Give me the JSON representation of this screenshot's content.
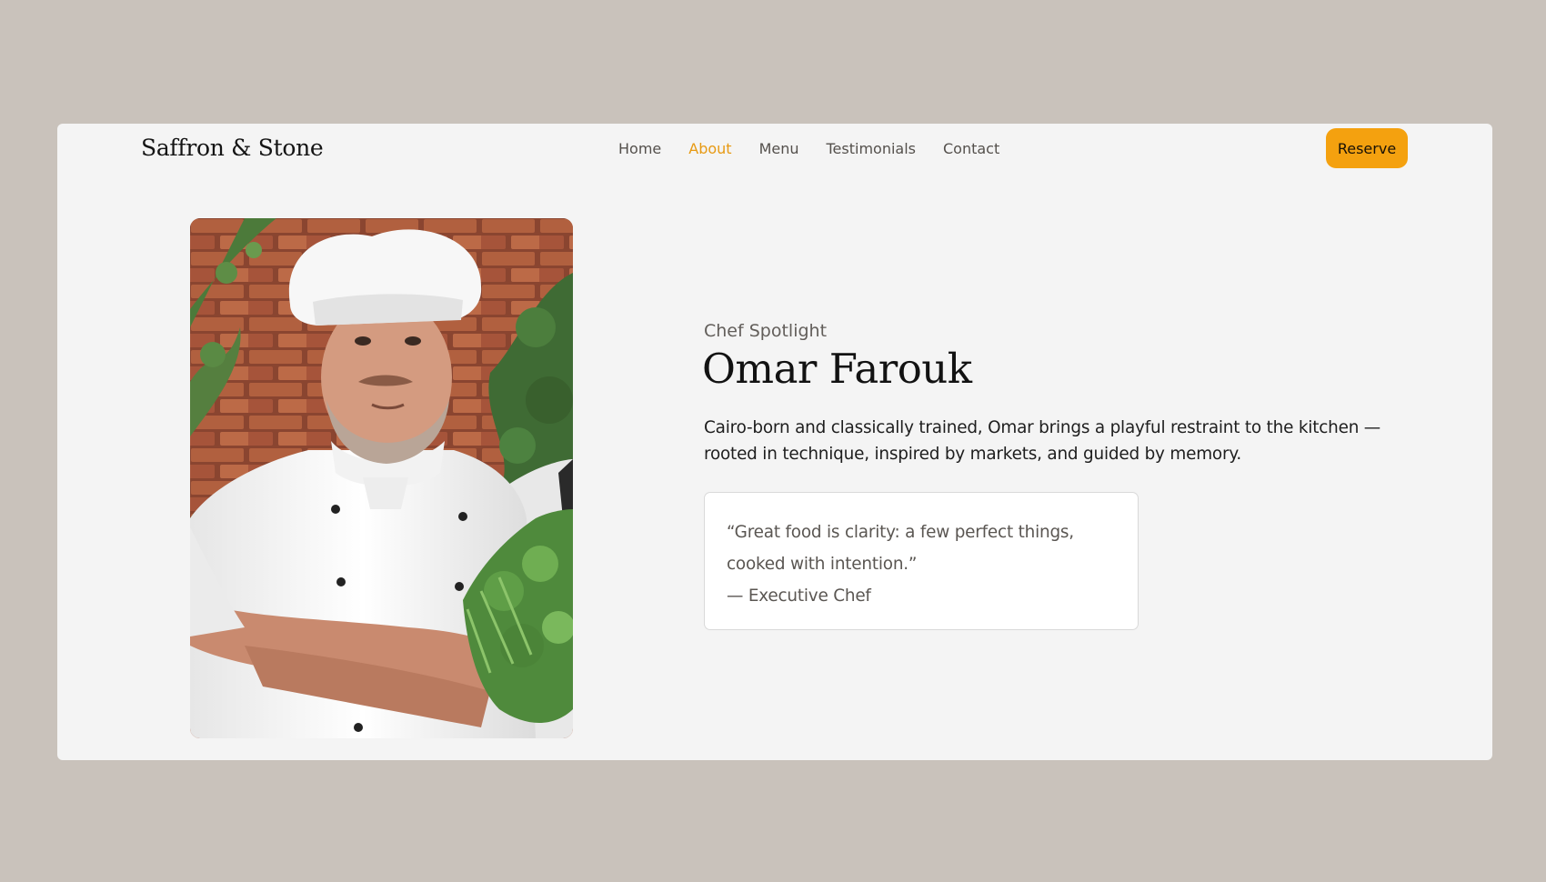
{
  "nav": {
    "brand": "Saffron & Stone",
    "links": [
      {
        "label": "Home",
        "active": false
      },
      {
        "label": "About",
        "active": true
      },
      {
        "label": "Menu",
        "active": false
      },
      {
        "label": "Testimonials",
        "active": false
      },
      {
        "label": "Contact",
        "active": false
      }
    ],
    "reserve_label": "Reserve"
  },
  "about": {
    "eyebrow": "Chef Spotlight",
    "name": "Omar Farouk",
    "bio": "Cairo-born and classically trained, Omar brings a playful restraint to the kitchen —rooted in technique, inspired by markets, and guided by memory.",
    "quote": {
      "text": "“Great food is clarity: a few perfect things, cooked with intention.”",
      "attribution": "— Executive Chef"
    }
  },
  "colors": {
    "accent": "#f4a10f",
    "active_link": "#e79a14",
    "page_background": "#c9c2bb",
    "card_background": "#f4f4f4"
  }
}
